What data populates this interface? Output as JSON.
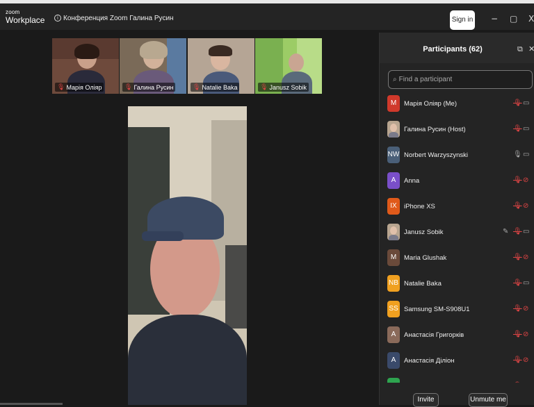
{
  "app": {
    "logo_small": "zoom",
    "logo_large": "Workplace",
    "meeting_title": "Конференция Zoom Галина Русин",
    "sign_in": "Sign in",
    "minimize_glyph": "−",
    "restore_glyph": "▢",
    "close_glyph": "X"
  },
  "gallery": [
    {
      "name": "Марія Оліяр",
      "bg": "#7a4b3a"
    },
    {
      "name": "Галина Русин",
      "bg": "#8a6f5a"
    },
    {
      "name": "Natalie Baka",
      "bg": "#9a8b7a"
    },
    {
      "name": "Janusz Sobik",
      "bg": "#8bbf5a"
    }
  ],
  "participants_panel": {
    "title": "Participants (62)",
    "search_placeholder": "Find a participant",
    "invite": "Invite",
    "unmute_me": "Unmute me",
    "participants": [
      {
        "initials": "M",
        "name": "Марія Оліяр (Me)",
        "color": "#d0392b",
        "mic": "muted",
        "video": "on",
        "photo": false,
        "edit": false
      },
      {
        "initials": "",
        "name": "Галина Русин (Host)",
        "color": "#b8a590",
        "mic": "muted",
        "video": "on",
        "photo": true,
        "edit": false
      },
      {
        "initials": "NW",
        "name": "Norbert Warzyszynski",
        "color": "#4a5f78",
        "mic": "on",
        "video": "on",
        "photo": false,
        "edit": false
      },
      {
        "initials": "A",
        "name": "Anna",
        "color": "#7a4fc9",
        "mic": "muted",
        "video": "off",
        "photo": false,
        "edit": false
      },
      {
        "initials": "IX",
        "name": "iPhone XS",
        "color": "#e05a1a",
        "mic": "muted",
        "video": "off",
        "photo": false,
        "edit": false
      },
      {
        "initials": "",
        "name": "Janusz Sobik",
        "color": "#b8a590",
        "mic": "muted",
        "video": "on",
        "photo": true,
        "edit": true
      },
      {
        "initials": "M",
        "name": "Maria Glushak",
        "color": "#6a4a3a",
        "mic": "muted",
        "video": "off",
        "photo": false,
        "edit": false
      },
      {
        "initials": "NB",
        "name": "Natalie Baka",
        "color": "#f0a020",
        "mic": "muted",
        "video": "on",
        "photo": false,
        "edit": false
      },
      {
        "initials": "SS",
        "name": "Samsung SM-S908U1",
        "color": "#f0a020",
        "mic": "muted",
        "video": "off",
        "photo": false,
        "edit": false
      },
      {
        "initials": "A",
        "name": "Анастасія Григорків",
        "color": "#8a6a5a",
        "mic": "muted",
        "video": "off",
        "photo": false,
        "edit": false
      },
      {
        "initials": "A",
        "name": "Анастасія Діліон",
        "color": "#3a4a6a",
        "mic": "muted",
        "video": "off",
        "photo": false,
        "edit": false
      },
      {
        "initials": "",
        "name": "",
        "color": "#2ea44f",
        "mic": "muted",
        "video": "off",
        "photo": false,
        "edit": false
      }
    ]
  }
}
